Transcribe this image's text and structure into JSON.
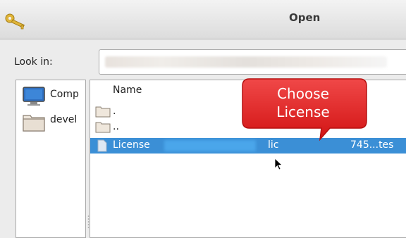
{
  "window": {
    "title": "Open",
    "icon": "keys-icon"
  },
  "lookin": {
    "label": "Look in:"
  },
  "sidebar": {
    "items": [
      {
        "label": "Comp",
        "icon": "computer-icon"
      },
      {
        "label": "devel",
        "icon": "folder-icon"
      }
    ]
  },
  "filelist": {
    "column_name": "Name",
    "rows": [
      {
        "name": ".",
        "icon": "folder-icon"
      },
      {
        "name": "..",
        "icon": "folder-icon"
      },
      {
        "name": "License",
        "ext": "lic",
        "size": "745...tes",
        "icon": "document-icon",
        "selected": true
      }
    ]
  },
  "callout": {
    "line1": "Choose",
    "line2": "License",
    "color": "#e02020"
  },
  "colors": {
    "selection": "#3b8fd6",
    "window_bg": "#ececec"
  }
}
